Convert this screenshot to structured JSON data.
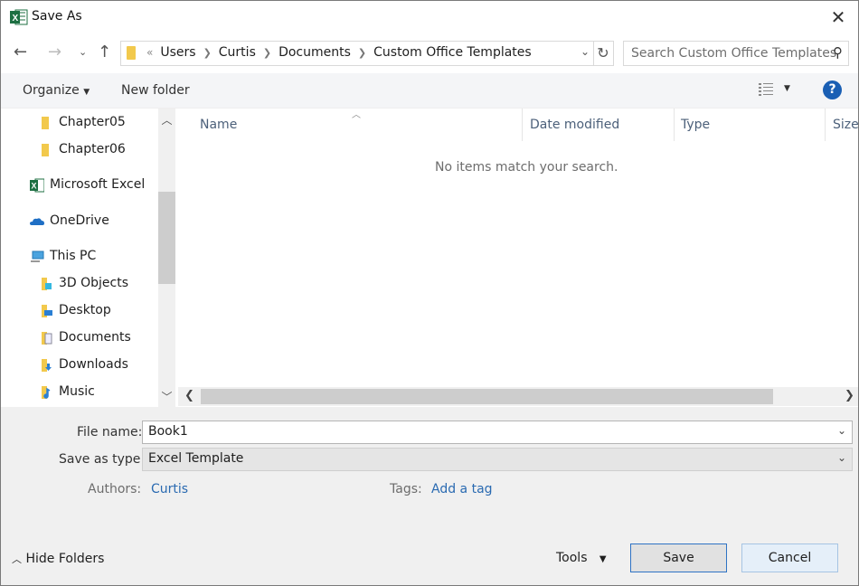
{
  "window": {
    "title": "Save As",
    "close_icon": "close-icon",
    "app_icon": "excel-icon"
  },
  "nav": {
    "back_icon": "arrow-left-icon",
    "forward_icon": "arrow-right-icon",
    "recent_icon": "chevron-down-icon",
    "up_icon": "arrow-up-icon",
    "overflow": "«",
    "breadcrumbs": [
      "Users",
      "Curtis",
      "Documents",
      "Custom Office Templates"
    ],
    "refresh_icon": "refresh-icon",
    "search_placeholder": "Search Custom Office Templates"
  },
  "toolbar": {
    "organize": "Organize",
    "new_folder": "New folder",
    "view_icon": "details-view-icon",
    "help_icon": "help-icon"
  },
  "sidebar": {
    "items": [
      {
        "label": "Chapter05",
        "icon": "folder-icon"
      },
      {
        "label": "Chapter06",
        "icon": "folder-icon"
      },
      {
        "label": "Microsoft Excel",
        "icon": "excel-icon"
      },
      {
        "label": "OneDrive",
        "icon": "cloud-icon"
      },
      {
        "label": "This PC",
        "icon": "computer-icon"
      },
      {
        "label": "3D Objects",
        "icon": "3d-objects-icon"
      },
      {
        "label": "Desktop",
        "icon": "desktop-icon"
      },
      {
        "label": "Documents",
        "icon": "documents-icon"
      },
      {
        "label": "Downloads",
        "icon": "downloads-icon"
      },
      {
        "label": "Music",
        "icon": "music-icon"
      }
    ]
  },
  "filelist": {
    "columns": [
      "Name",
      "Date modified",
      "Type",
      "Size"
    ],
    "empty_message": "No items match your search."
  },
  "form": {
    "file_name_label": "File name:",
    "file_name_value": "Book1",
    "type_label": "Save as type:",
    "type_value": "Excel Template",
    "authors_label": "Authors:",
    "authors_value": "Curtis",
    "tags_label": "Tags:",
    "tags_value": "Add a tag"
  },
  "footer": {
    "hide_folders": "Hide Folders",
    "tools": "Tools",
    "save": "Save",
    "cancel": "Cancel"
  },
  "colors": {
    "accent": "#2a6ab1",
    "help": "#1a5fb4",
    "save_border": "#2f73c4"
  }
}
